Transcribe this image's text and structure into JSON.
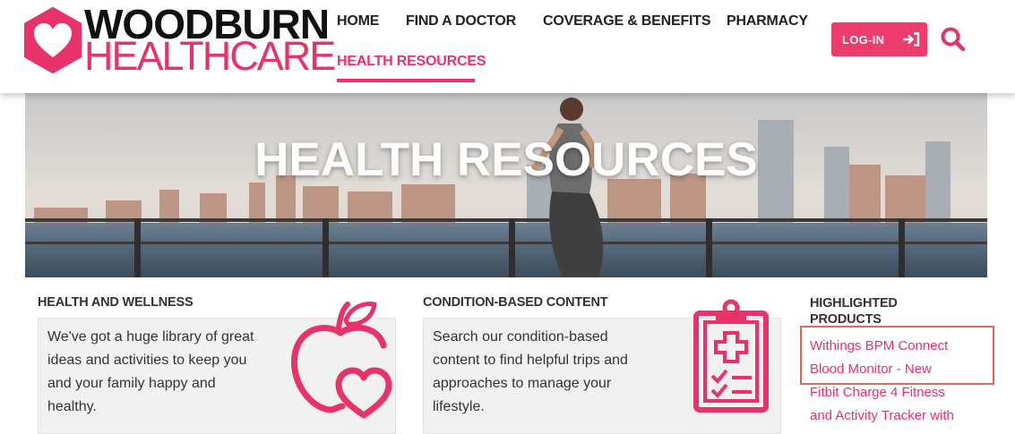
{
  "brand": {
    "line1": "WOODBURN",
    "line2": "HEALTHCARE",
    "accent_color": "#e8336a"
  },
  "nav": {
    "items": [
      {
        "label": "HOME"
      },
      {
        "label": "FIND A DOCTOR"
      },
      {
        "label": "COVERAGE & BENEFITS"
      },
      {
        "label": "PHARMACY"
      },
      {
        "label": "HEALTH RESOURCES",
        "active": true
      }
    ],
    "login_label": "LOG-IN",
    "login_icon": "login-arrow-icon",
    "search_icon": "search-icon"
  },
  "hero": {
    "title": "HEALTH RESOURCES"
  },
  "sections": {
    "wellness": {
      "heading": "HEALTH AND WELLNESS",
      "lines": [
        "We've got a huge library of great",
        "ideas and activities to keep you",
        "and your family happy and",
        "healthy."
      ],
      "icon": "apple-heart-icon"
    },
    "condition": {
      "heading": "CONDITION-BASED CONTENT",
      "lines": [
        "Search our condition-based",
        "content to find helpful trips and",
        "approaches to manage your",
        "lifestyle."
      ],
      "icon": "clipboard-checklist-icon"
    },
    "products": {
      "heading_line1": "HIGHLIGHTED",
      "heading_line2": "PRODUCTS",
      "links": [
        {
          "line1": "Withings BPM Connect",
          "line2": "Blood Monitor - New"
        },
        {
          "line1": "Fitbit Charge 4 Fitness",
          "line2": "and Activity Tracker with"
        }
      ]
    }
  }
}
